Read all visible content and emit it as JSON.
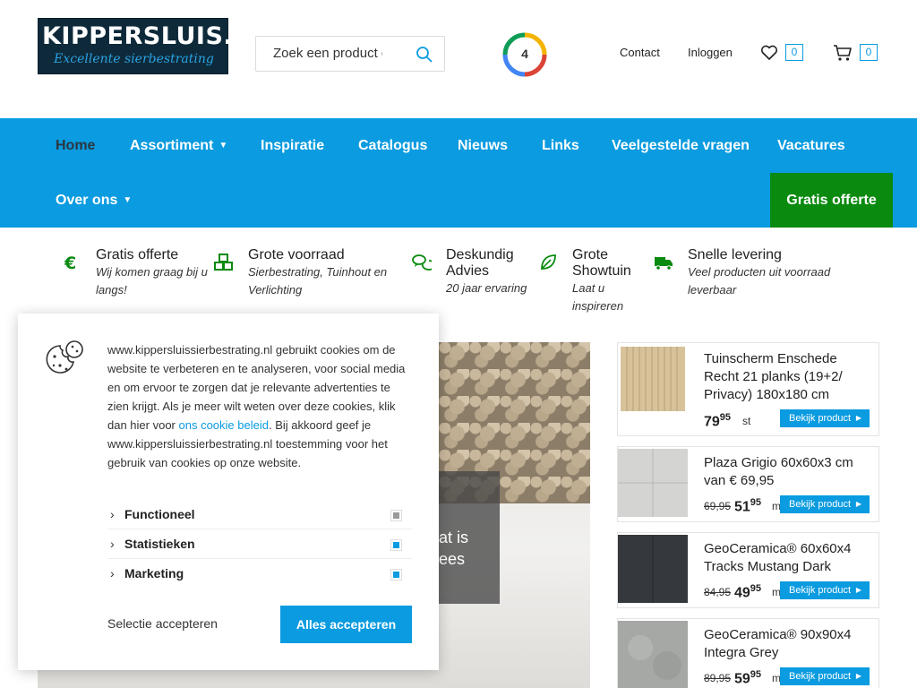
{
  "header": {
    "logo_title": "KIPPERSLUIS.NL",
    "logo_tagline": "Excellente sierbestrating",
    "search_placeholder": "Zoek een product of",
    "rating": "4",
    "contact": "Contact",
    "login": "Inloggen",
    "wishlist_count": "0",
    "cart_count": "0"
  },
  "nav": {
    "items": [
      "Home",
      "Assortiment",
      "Inspiratie",
      "Catalogus",
      "Nieuws",
      "Links",
      "Veelgestelde vragen",
      "Vacatures",
      "Over ons"
    ],
    "cta": "Gratis offerte"
  },
  "usps": [
    {
      "icon": "euro-icon",
      "title": "Gratis offerte",
      "sub": [
        "Wij komen graag bij u",
        "langs!"
      ]
    },
    {
      "icon": "cubes-icon",
      "title": "Grote voorraad",
      "sub": [
        "Sierbestrating, Tuinhout en",
        "Verlichting"
      ]
    },
    {
      "icon": "chat-icon",
      "title1": "Deskundig",
      "title2": "Advies",
      "sub": [
        "20 jaar ervaring"
      ]
    },
    {
      "icon": "leaf-icon",
      "title1": "Grote",
      "title2": "Showtuin",
      "sub": [
        "Laat u",
        "inspireren"
      ]
    },
    {
      "icon": "truck-icon",
      "title": "Snelle levering",
      "sub": [
        "Veel producten uit voorraad",
        "leverbaar"
      ]
    }
  ],
  "hero": {
    "line1": "at is",
    "line2": "ees"
  },
  "products": [
    {
      "name": "Tuinscherm Enschede Recht 21 planks (19+2/ Privacy) 180x180 cm",
      "old": "",
      "price": "79",
      "cents": "95",
      "unit": "st",
      "button": "Bekijk product"
    },
    {
      "name": "Plaza Grigio 60x60x3 cm van € 69,95",
      "old": "69,95",
      "price": "51",
      "cents": "95",
      "unit": "m",
      "button": "Bekijk product"
    },
    {
      "name": "GeoCeramica® 60x60x4 Tracks Mustang Dark",
      "old": "84,95",
      "price": "49",
      "cents": "95",
      "unit": "m",
      "button": "Bekijk product"
    },
    {
      "name": "GeoCeramica® 90x90x4 Integra Grey",
      "old": "89,95",
      "price": "59",
      "cents": "95",
      "unit": "m",
      "button": "Bekijk product"
    }
  ],
  "cookie": {
    "text_before": "www.kippersluissierbestrating.nl gebruikt cookies om de website te verbeteren en te analyseren, voor social media en om ervoor te zorgen dat je relevante advertenties te zien krijgt. Als je meer wilt weten over deze cookies, klik dan hier voor ",
    "link": "ons cookie beleid",
    "text_after": ". Bij akkoord geef je www.kippersluissierbestrating.nl toestemming voor het gebruik van cookies op onze website.",
    "categories": [
      {
        "label": "Functioneel",
        "color": "#9a9a9a"
      },
      {
        "label": "Statistieken",
        "color": "#0a9be0"
      },
      {
        "label": "Marketing",
        "color": "#0a9be0"
      }
    ],
    "select_label": "Selectie accepteren",
    "accept_label": "Alles accepteren"
  },
  "colors": {
    "primary": "#0a9be0",
    "cta_green": "#0a8a0f"
  }
}
